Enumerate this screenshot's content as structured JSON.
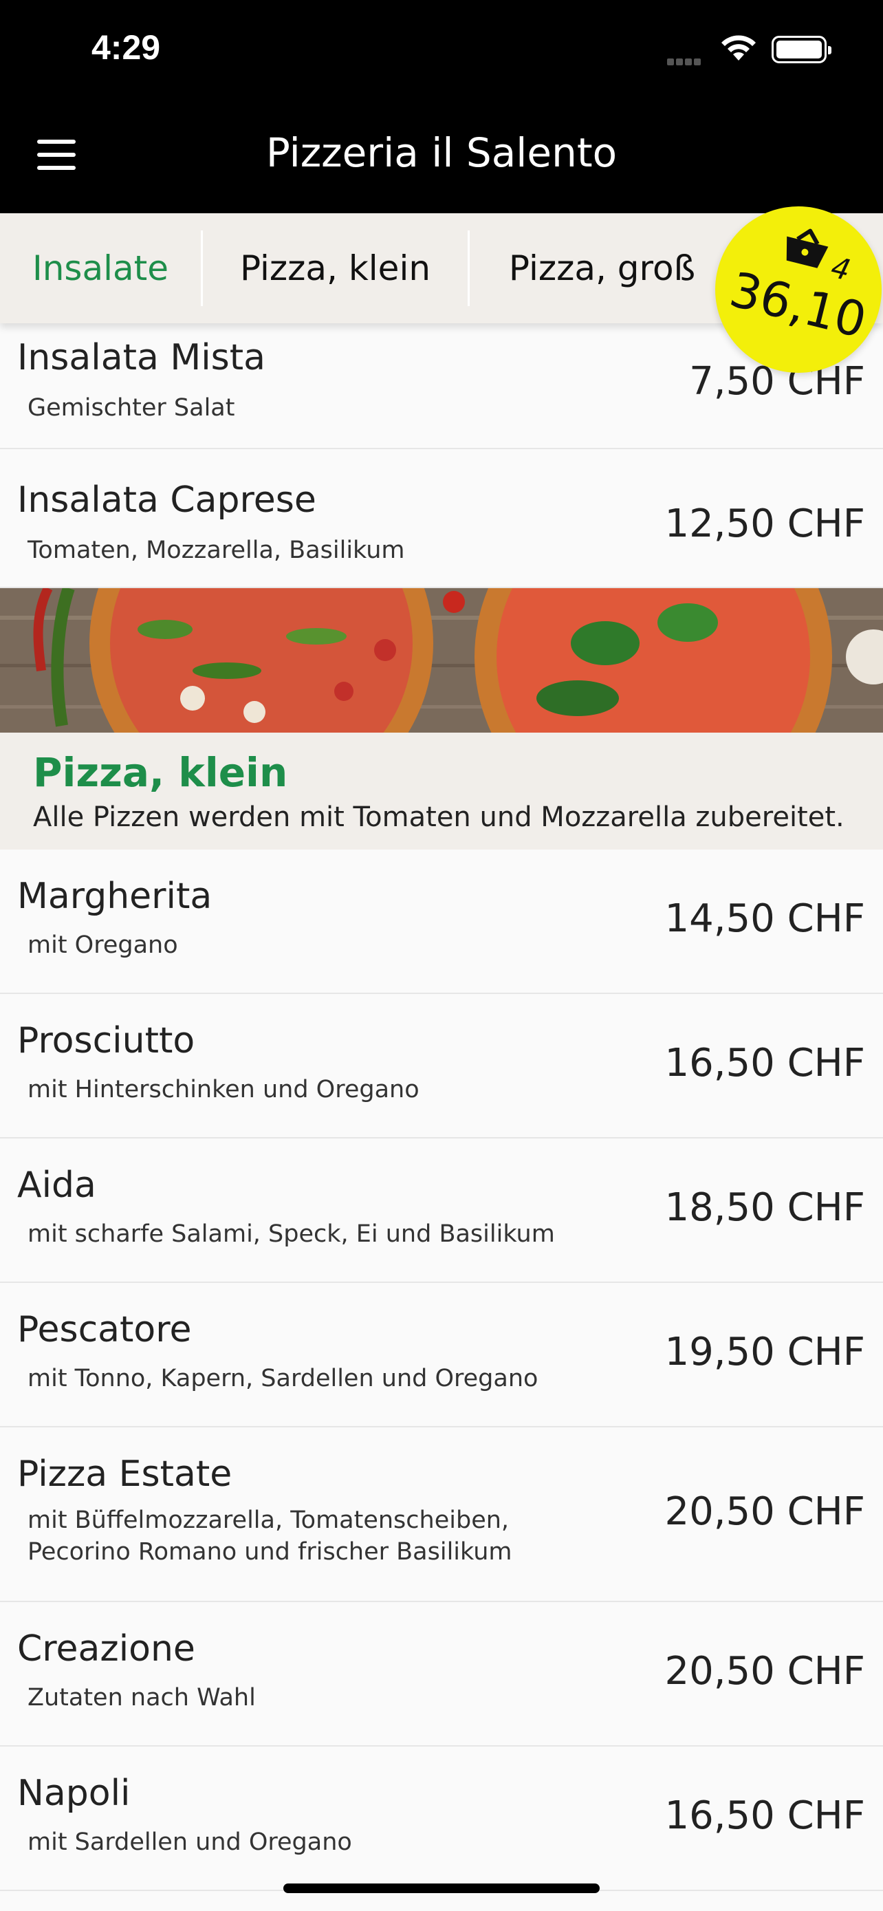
{
  "status_bar": {
    "time": "4:29"
  },
  "header": {
    "title": "Pizzeria il Salento",
    "menu_icon": "hamburger-menu-icon"
  },
  "tabs": [
    {
      "label": "Insalate",
      "active": true
    },
    {
      "label": "Pizza, klein",
      "active": false
    },
    {
      "label": "Pizza, groß",
      "active": false
    }
  ],
  "cart": {
    "icon": "shopping-basket-icon",
    "count": "4",
    "total": "36,10",
    "color": "#f3ef0a"
  },
  "salads": [
    {
      "name": "Insalata Mista",
      "desc": "Gemischter Salat",
      "price": "7,50 CHF"
    },
    {
      "name": "Insalata Caprese",
      "desc": "Tomaten, Mozzarella, Basilikum",
      "price": "12,50 CHF"
    }
  ],
  "section": {
    "title": "Pizza, klein",
    "subtitle": "Alle Pizzen werden mit Tomaten und Mozzarella zubereitet."
  },
  "pizzas": [
    {
      "name": "Margherita",
      "desc": "mit Oregano",
      "price": "14,50 CHF"
    },
    {
      "name": "Prosciutto",
      "desc": "mit Hinterschinken und Oregano",
      "price": "16,50 CHF"
    },
    {
      "name": "Aida",
      "desc": "mit scharfe Salami, Speck, Ei und Basilikum",
      "price": "18,50 CHF"
    },
    {
      "name": "Pescatore",
      "desc": "mit Tonno, Kapern, Sardellen und Oregano",
      "price": "19,50 CHF"
    },
    {
      "name": "Pizza Estate",
      "desc": "mit Büffelmozzarella, Tomatenscheiben, Pecorino Romano und frischer Basilikum",
      "price": "20,50 CHF"
    },
    {
      "name": "Creazione",
      "desc": "Zutaten nach Wahl",
      "price": "20,50 CHF"
    },
    {
      "name": "Napoli",
      "desc": "mit Sardellen und Oregano",
      "price": "16,50 CHF"
    }
  ],
  "colors": {
    "accent_green": "#1e8e4a",
    "header_bg": "#000000",
    "section_bg": "#f1eeea"
  }
}
